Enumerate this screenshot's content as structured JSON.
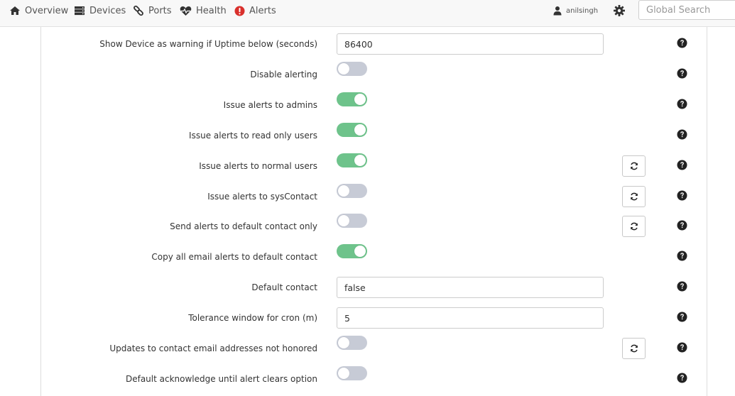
{
  "nav": {
    "items": [
      {
        "label": "Overview",
        "icon": "home-icon"
      },
      {
        "label": "Devices",
        "icon": "server-icon"
      },
      {
        "label": "Ports",
        "icon": "link-icon"
      },
      {
        "label": "Health",
        "icon": "heartbeat-icon"
      },
      {
        "label": "Alerts",
        "icon": "exclamation-circle-icon"
      }
    ],
    "username": "anilsingh",
    "settings_icon": "gear-icon",
    "search_placeholder": "Global Search"
  },
  "colors": {
    "toggle_on": "#6ec38b",
    "toggle_off": "#c7cbd6",
    "alert_icon": "#d9302c"
  },
  "settings": [
    {
      "label": "Show Device as warning if Uptime below (seconds)",
      "type": "text",
      "value": "86400",
      "reset": false
    },
    {
      "label": "Disable alerting",
      "type": "toggle",
      "on": false,
      "reset": false
    },
    {
      "label": "Issue alerts to admins",
      "type": "toggle",
      "on": true,
      "reset": false
    },
    {
      "label": "Issue alerts to read only users",
      "type": "toggle",
      "on": true,
      "reset": false
    },
    {
      "label": "Issue alerts to normal users",
      "type": "toggle",
      "on": true,
      "reset": true
    },
    {
      "label": "Issue alerts to sysContact",
      "type": "toggle",
      "on": false,
      "reset": true
    },
    {
      "label": "Send alerts to default contact only",
      "type": "toggle",
      "on": false,
      "reset": true
    },
    {
      "label": "Copy all email alerts to default contact",
      "type": "toggle",
      "on": true,
      "reset": false
    },
    {
      "label": "Default contact",
      "type": "text",
      "value": "false",
      "reset": false
    },
    {
      "label": "Tolerance window for cron (m)",
      "type": "text",
      "value": "5",
      "reset": false
    },
    {
      "label": "Updates to contact email addresses not honored",
      "type": "toggle",
      "on": false,
      "reset": true
    },
    {
      "label": "Default acknowledge until alert clears option",
      "type": "toggle",
      "on": false,
      "reset": false
    }
  ]
}
